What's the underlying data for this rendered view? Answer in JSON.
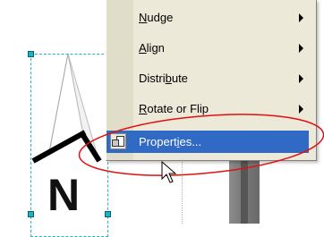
{
  "menu": {
    "items": [
      {
        "pre": "",
        "ul": "N",
        "post": "udge",
        "submenu": true
      },
      {
        "pre": "",
        "ul": "A",
        "post": "lign",
        "submenu": true
      },
      {
        "pre": "Distri",
        "ul": "b",
        "post": "ute",
        "submenu": true
      },
      {
        "pre": "",
        "ul": "R",
        "post": "otate or Flip",
        "submenu": true
      },
      {
        "pre": "Propert",
        "ul": "i",
        "post": "es...",
        "submenu": false
      }
    ]
  },
  "north_arrow": {
    "letter": "N"
  },
  "colors": {
    "menu_bg": "#ece9d8",
    "highlight": "#316ac5",
    "annotation_ellipse": "#e01010",
    "selection_handles": "#18b4c5"
  }
}
